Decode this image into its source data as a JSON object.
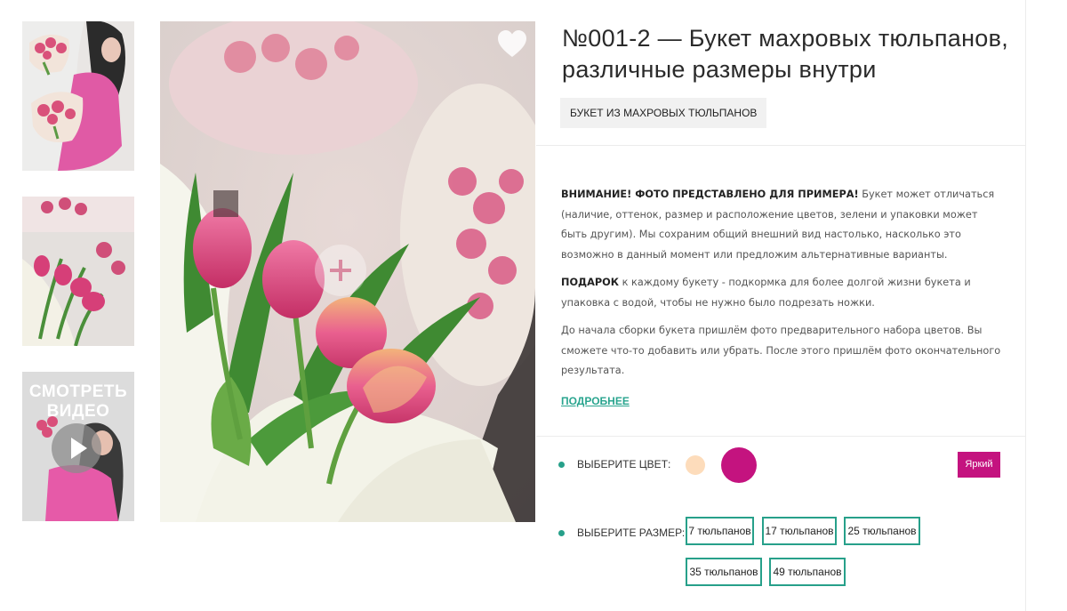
{
  "thumbnails": [
    {
      "alt": "photo-1"
    },
    {
      "alt": "photo-2"
    },
    {
      "label": "СМОТРЕТЬ ВИДЕО"
    }
  ],
  "product": {
    "title": "№001-2 — Букет махровых тюльпанов, различные размеры внутри",
    "category": "БУКЕТ ИЗ МАХРОВЫХ ТЮЛЬПАНОВ"
  },
  "description": {
    "p1_strong": "ВНИМАНИЕ! ФОТО ПРЕДСТАВЛЕНО ДЛЯ ПРИМЕРА!",
    "p1_text": " Букет может отличаться (наличие, оттенок, размер и расположение цветов, зелени и упаковки может быть другим). Мы сохраним общий внешний вид настолько, насколько это возможно в данный момент или предложим альтернативные варианты.",
    "p2_strong": "ПОДАРОК",
    "p2_text": " к каждому букету - подкормка для более долгой жизни букета и упаковка с водой, чтобы не нужно было подрезать ножки.",
    "p3_text": "До начала сборки букета пришлём фото предварительного набора цветов. Вы сможете что-то добавить или убрать. После этого пришлём фото окончательного результата.",
    "more_link": "ПОДРОБНЕЕ"
  },
  "color_option": {
    "label": "ВЫБЕРИТЕ ЦВЕТ:",
    "swatches": [
      {
        "name": "pastel",
        "color": "#fddcbb"
      },
      {
        "name": "bright",
        "color": "#c4137f"
      }
    ],
    "selected_label": "Яркий",
    "selected_color": "#c4137f"
  },
  "size_option": {
    "label": "ВЫБЕРИТЕ РАЗМЕР:",
    "sizes": [
      "7 тюльпанов",
      "17 тюльпанов",
      "25 тюльпанов",
      "35 тюльпанов",
      "49 тюльпанов"
    ]
  },
  "colors": {
    "accent": "#27a08a",
    "link": "#2aa58f"
  }
}
